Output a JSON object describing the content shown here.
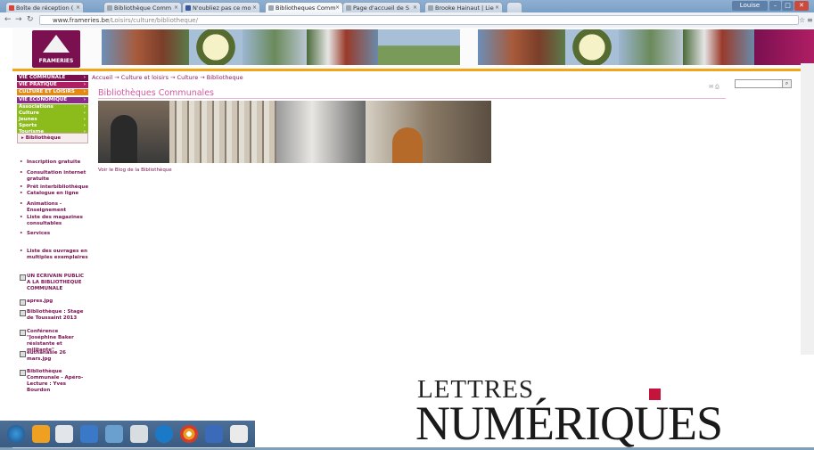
{
  "browser": {
    "tabs": [
      {
        "label": "Boîte de réception (",
        "active": false,
        "favicon_color": "#d44638"
      },
      {
        "label": "Bibliothèque Comm",
        "active": false,
        "favicon_color": "#9aa5b0"
      },
      {
        "label": "N'oubliez pas ce mo",
        "active": false,
        "favicon_color": "#3b5998"
      },
      {
        "label": "Bibliotheques Comm",
        "active": true,
        "favicon_color": "#9aa5b0"
      },
      {
        "label": "Page d'accueil de S",
        "active": false,
        "favicon_color": "#9aa5b0"
      },
      {
        "label": "Brooke Hainaut | Lie",
        "active": false,
        "favicon_color": "#9aa5b0"
      }
    ],
    "url_host": "www.frameries.be",
    "url_path": "/Loisirs/culture/bibliotheque/",
    "window_button_label": "Louise"
  },
  "site": {
    "logo_text": "FRAMERIES",
    "breadcrumb": "Accueil → Culture et loisirs → Culture → Bibliotheque",
    "page_title": "Bibliothèques Communales",
    "blog_link": "Voir le Blog de la Bibliothèque",
    "top_menu": [
      {
        "label": "VIE COMMUNALE",
        "color": "#7a1050"
      },
      {
        "label": "VIE PRATIQUE",
        "color": "#b01e64"
      },
      {
        "label": "CULTURE ET LOISIRS",
        "color": "#e48a12"
      },
      {
        "label": "VIE ECONOMIQUE",
        "color": "#8c2a8a"
      }
    ],
    "green_menu": [
      "Associations",
      "Culture",
      "Jeunes",
      "Sports",
      "Tourisme"
    ],
    "green_color": "#8cbc1c",
    "active_section": "Bibliothèque",
    "side_items": [
      {
        "label": "Inscription gratuite",
        "doc": false
      },
      {
        "label": "Consultation internet gratuite",
        "doc": false
      },
      {
        "label": "Prêt interbibliothèque",
        "doc": false
      },
      {
        "label": "Catalogue en ligne",
        "doc": false
      },
      {
        "label": "Animations - Enseignement",
        "doc": false
      },
      {
        "label": "Liste des magazines consultables",
        "doc": false
      },
      {
        "label": "Services",
        "doc": false
      },
      {
        "label": "Liste des ouvrages en multiples exemplaires",
        "doc": false
      },
      {
        "label": "UN ECRIVAIN PUBLIC A LA BIBLIOTHEQUE COMMUNALE",
        "doc": true
      },
      {
        "label": "apres.jpg",
        "doc": true
      },
      {
        "label": "Bibliothèque : Stage de Toussaint 2013",
        "doc": true
      },
      {
        "label": "Conférence \"Joséphine Baker résistante et militante\"",
        "doc": true
      },
      {
        "label": "euthanasie 26 mars.jpg",
        "doc": true
      },
      {
        "label": "Bibliothèque Communale - Apéro-Lecture : Yves Bourdon",
        "doc": true
      }
    ],
    "accent": "#7a1050",
    "title_color": "#d25aa0"
  },
  "overlay": {
    "line1": "LETTRES",
    "line2": "NUMÉRIQUES",
    "square_color": "#c4143c"
  }
}
